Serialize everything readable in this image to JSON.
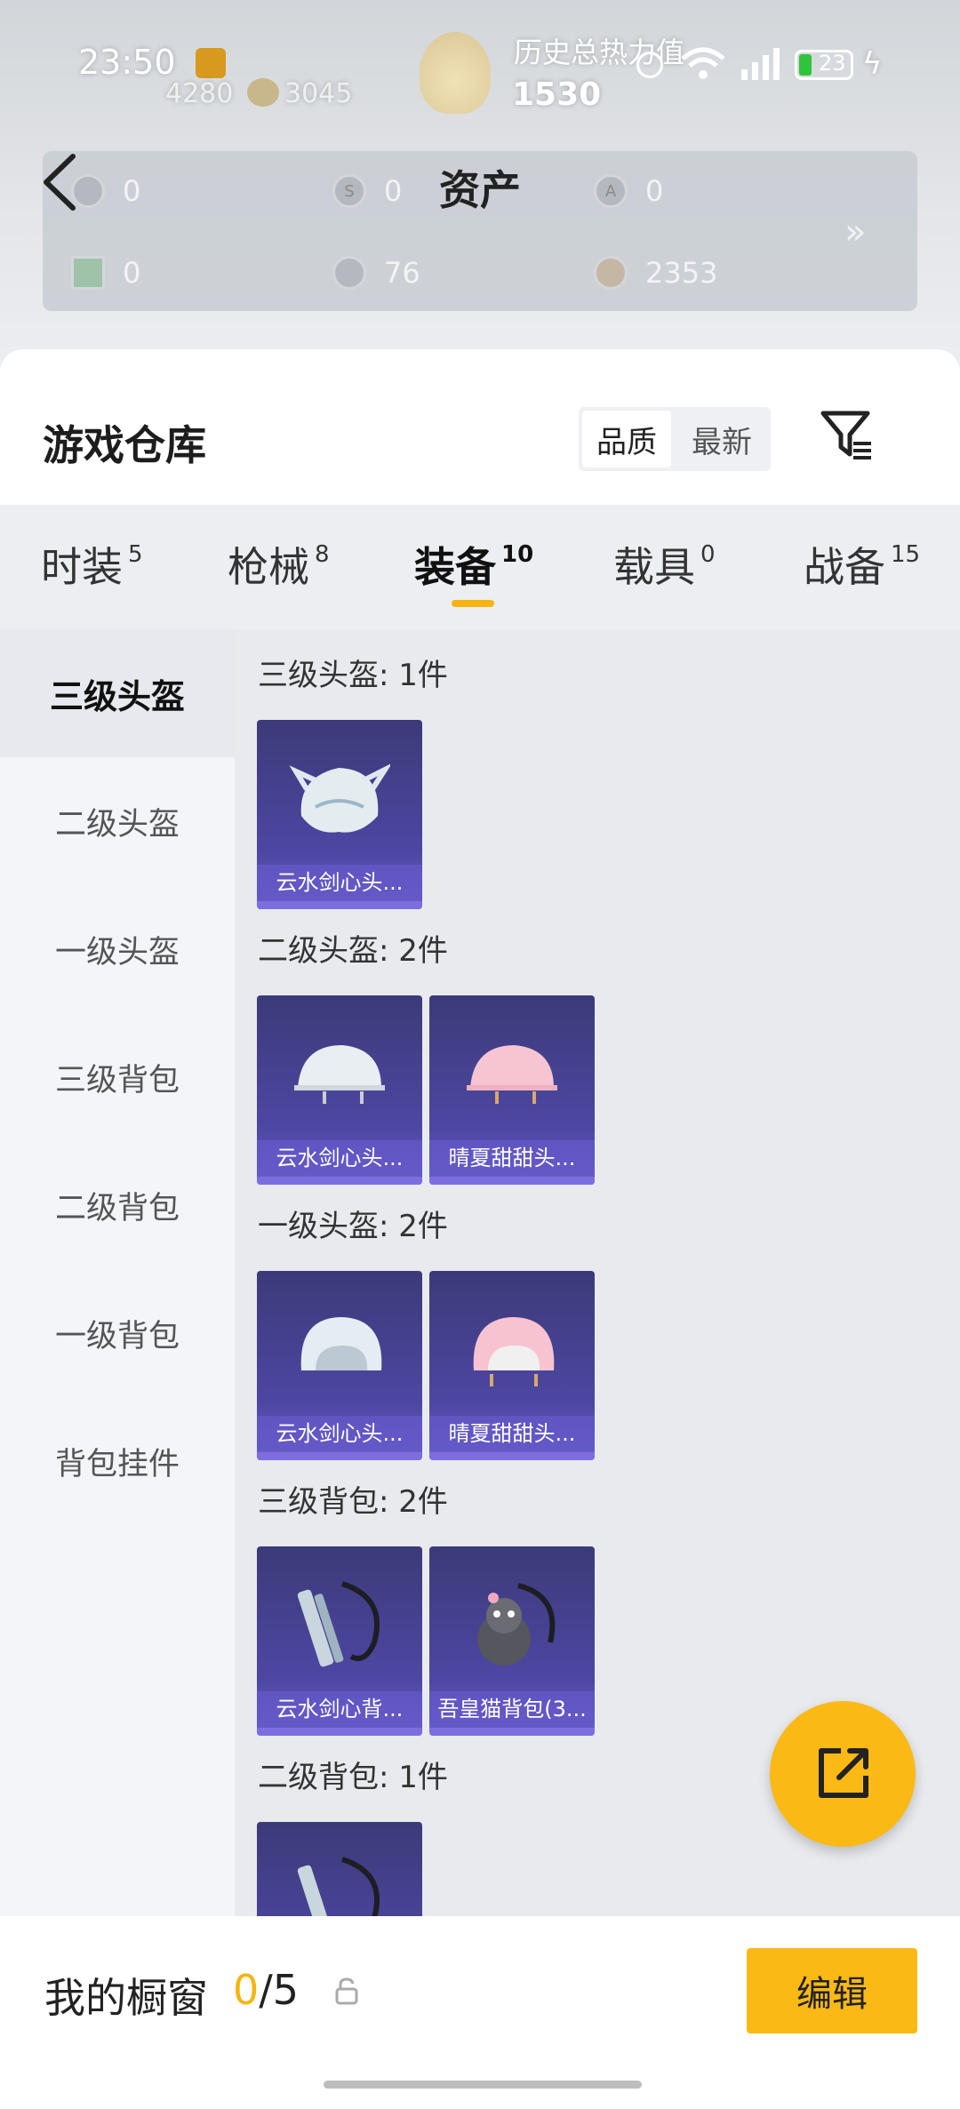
{
  "status_bar": {
    "time": "23:50",
    "small_value_a": "4280",
    "small_value_b": "3045",
    "history_label": "历史总热力值",
    "heat_value": "1530",
    "battery": "23"
  },
  "assets": {
    "title": "资产",
    "items": [
      {
        "icon": "card-icon",
        "value": "0"
      },
      {
        "icon": "s-coin-icon",
        "value": "0"
      },
      {
        "icon": "a-badge-icon",
        "value": "0"
      },
      {
        "icon": "green-card-icon",
        "value": "0"
      },
      {
        "icon": "silver-coin-icon",
        "value": "76"
      },
      {
        "icon": "bronze-coin-icon",
        "value": "2353"
      }
    ],
    "more": "»"
  },
  "warehouse": {
    "title": "游戏仓库",
    "sort": {
      "quality": "品质",
      "latest": "最新"
    }
  },
  "tabs": [
    {
      "label": "时装",
      "count": "5"
    },
    {
      "label": "枪械",
      "count": "8"
    },
    {
      "label": "装备",
      "count": "10",
      "active": true
    },
    {
      "label": "载具",
      "count": "0"
    },
    {
      "label": "战备",
      "count": "15"
    }
  ],
  "sidebar": {
    "items": [
      {
        "label": "三级头盔",
        "active": true
      },
      {
        "label": "二级头盔"
      },
      {
        "label": "一级头盔"
      },
      {
        "label": "三级背包"
      },
      {
        "label": "二级背包"
      },
      {
        "label": "一级背包"
      },
      {
        "label": "背包挂件"
      }
    ]
  },
  "groups": [
    {
      "title": "三级头盔: 1件",
      "items": [
        "云水剑心头..."
      ]
    },
    {
      "title": "二级头盔: 2件",
      "items": [
        "云水剑心头...",
        "晴夏甜甜头..."
      ]
    },
    {
      "title": "一级头盔: 2件",
      "items": [
        "云水剑心头...",
        "晴夏甜甜头..."
      ]
    },
    {
      "title": "三级背包: 2件",
      "items": [
        "云水剑心背...",
        "吾皇猫背包(3..."
      ]
    },
    {
      "title": "二级背包: 1件",
      "items": [
        ""
      ]
    }
  ],
  "showcase": {
    "label": "我的橱窗",
    "used": "0",
    "sep_total": "/5",
    "edit": "编辑"
  },
  "colors": {
    "accent": "#fbb915",
    "card": "#4d47a3"
  }
}
